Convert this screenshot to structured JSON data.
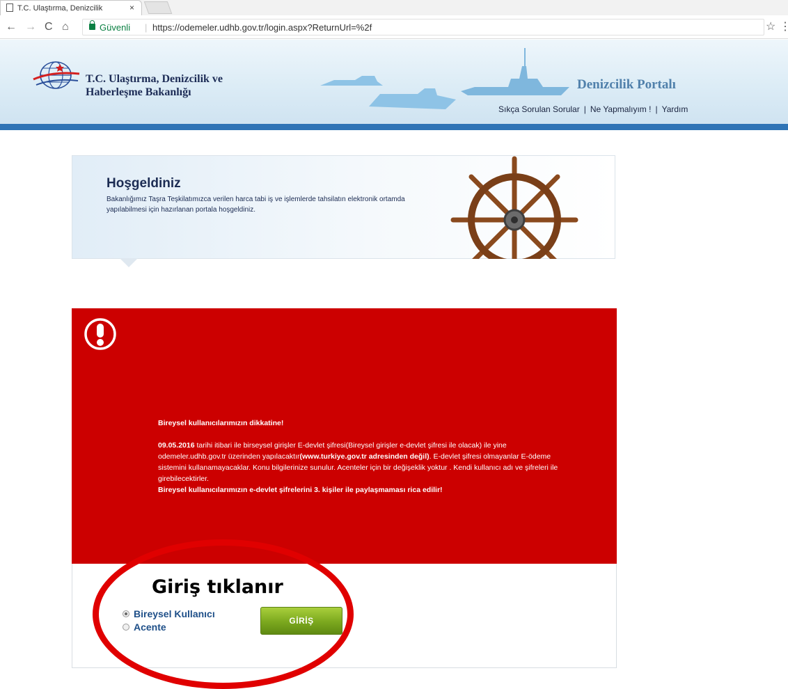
{
  "browser": {
    "tab_title": "T.C. Ulaştırma, Denizcilik",
    "tab_close": "×",
    "nav": {
      "back": "←",
      "forward": "→",
      "reload": "C",
      "home": "⌂"
    },
    "secure_label": "Güvenli",
    "url": "https://odemeler.udhb.gov.tr/login.aspx?ReturnUrl=%2f",
    "star": "☆",
    "menu": "⋮"
  },
  "header": {
    "ministry_line1": "T.C. Ulaştırma, Denizcilik ve",
    "ministry_line2": "Haberleşme Bakanlığı",
    "portal_title": "Denizcilik Portalı",
    "links": [
      "Sıkça Sorulan Sorular",
      "Ne Yapmalıyım !",
      "Yardım"
    ],
    "link_separator": "|"
  },
  "welcome": {
    "title": "Hoşgeldiniz",
    "text": "Bakanlığımız Taşra Teşkilatımızca verilen harca tabi iş ve işlemlerde tahsilatın elektronik ortamda yapılabilmesi için hazırlanan portala hoşgeldiniz."
  },
  "notice": {
    "heading": "Bireysel kullanıcılarımızın dikkatine!",
    "date": "09.05.2016",
    "p1": " tarihi itibari ile  birseysel girişler E-devlet şifresi(Bireysel girişler e-devlet şifresi ile olacak) ile yine odemeler.udhb.gov.tr üzerinden yapılacaktır",
    "p1_bold": "(www.turkiye.gov.tr adresinden değil)",
    "p2": ". E-devlet şifresi olmayanlar E-ödeme sistemini kullanamayacaklar. Konu bilgilerinize sunulur.  Acenteler  için bir değişeklik yoktur . Kendi kullanıcı adı ve şifreleri ile girebilecektirler.",
    "closing": "Bireysel kullanıcılarımızın e-devlet şifrelerini 3. kişiler ile paylaşmaması rica edilir!"
  },
  "login": {
    "options": [
      {
        "label": "Bireysel Kullanıcı",
        "selected": true
      },
      {
        "label": "Acente",
        "selected": false
      }
    ],
    "button_label": "GİRİŞ"
  },
  "annotation": {
    "text": "Giriş tıklanır",
    "color": "#e00000"
  },
  "colors": {
    "notice_red": "#cc0000",
    "header_bar": "#2f74b6",
    "portal_title": "#5080ab",
    "button_green": "#7ba81e"
  }
}
